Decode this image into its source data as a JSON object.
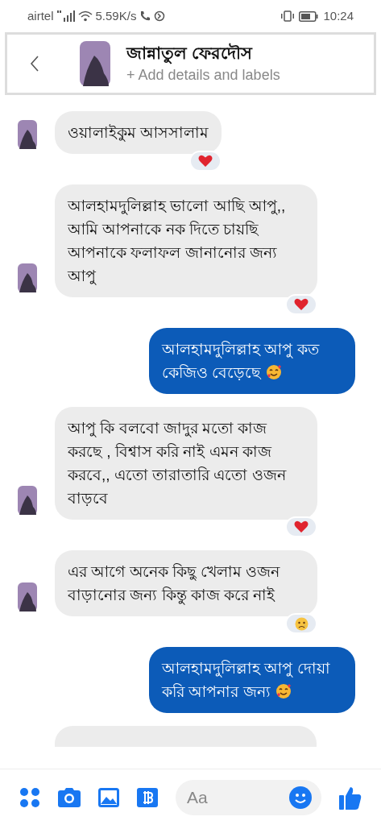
{
  "status_bar": {
    "carrier": "airtel",
    "speed": "5.59K/s",
    "time": "10:24"
  },
  "header": {
    "name": "জান্নাতুল ফেরদৌস",
    "subtitle": "+ Add details and labels"
  },
  "messages": [
    {
      "kind": "incoming",
      "text": "ওয়ালাইকুম আসসালাম",
      "trailing_emoji": false,
      "reaction": {
        "kind": "heart"
      }
    },
    {
      "kind": "incoming",
      "text": "আলহামদুলিল্লাহ ভালো আছি আপু,, আমি আপনাকে নক দিতে চায়ছি আপনাকে ফলাফল জানানোর জন্য আপু",
      "trailing_emoji": false,
      "reaction": {
        "kind": "heart"
      }
    },
    {
      "kind": "outgoing",
      "text": "আলহামদুলিল্লাহ আপু  কত কেজিও বেড়েছে",
      "trailing_emoji": true
    },
    {
      "kind": "incoming",
      "text": "আপু কি বলবো জাদুর মতো কাজ করছে , বিশ্বাস করি নাই এমন কাজ করবে,, এতো তারাতারি এতো ওজন বাড়বে",
      "trailing_emoji": false,
      "reaction": {
        "kind": "heart"
      }
    },
    {
      "kind": "incoming",
      "text": "এর আগে অনেক কিছু খেলাম ওজন বাড়ানোর জন্য কিন্তু কাজ করে নাই",
      "trailing_emoji": false,
      "reaction": {
        "kind": "sad"
      }
    },
    {
      "kind": "outgoing",
      "text": "আলহামদুলিল্লাহ আপু দোয়া করি আপনার জন্য",
      "trailing_emoji": true
    },
    {
      "kind": "partial"
    }
  ],
  "composer": {
    "placeholder": "Aa"
  }
}
